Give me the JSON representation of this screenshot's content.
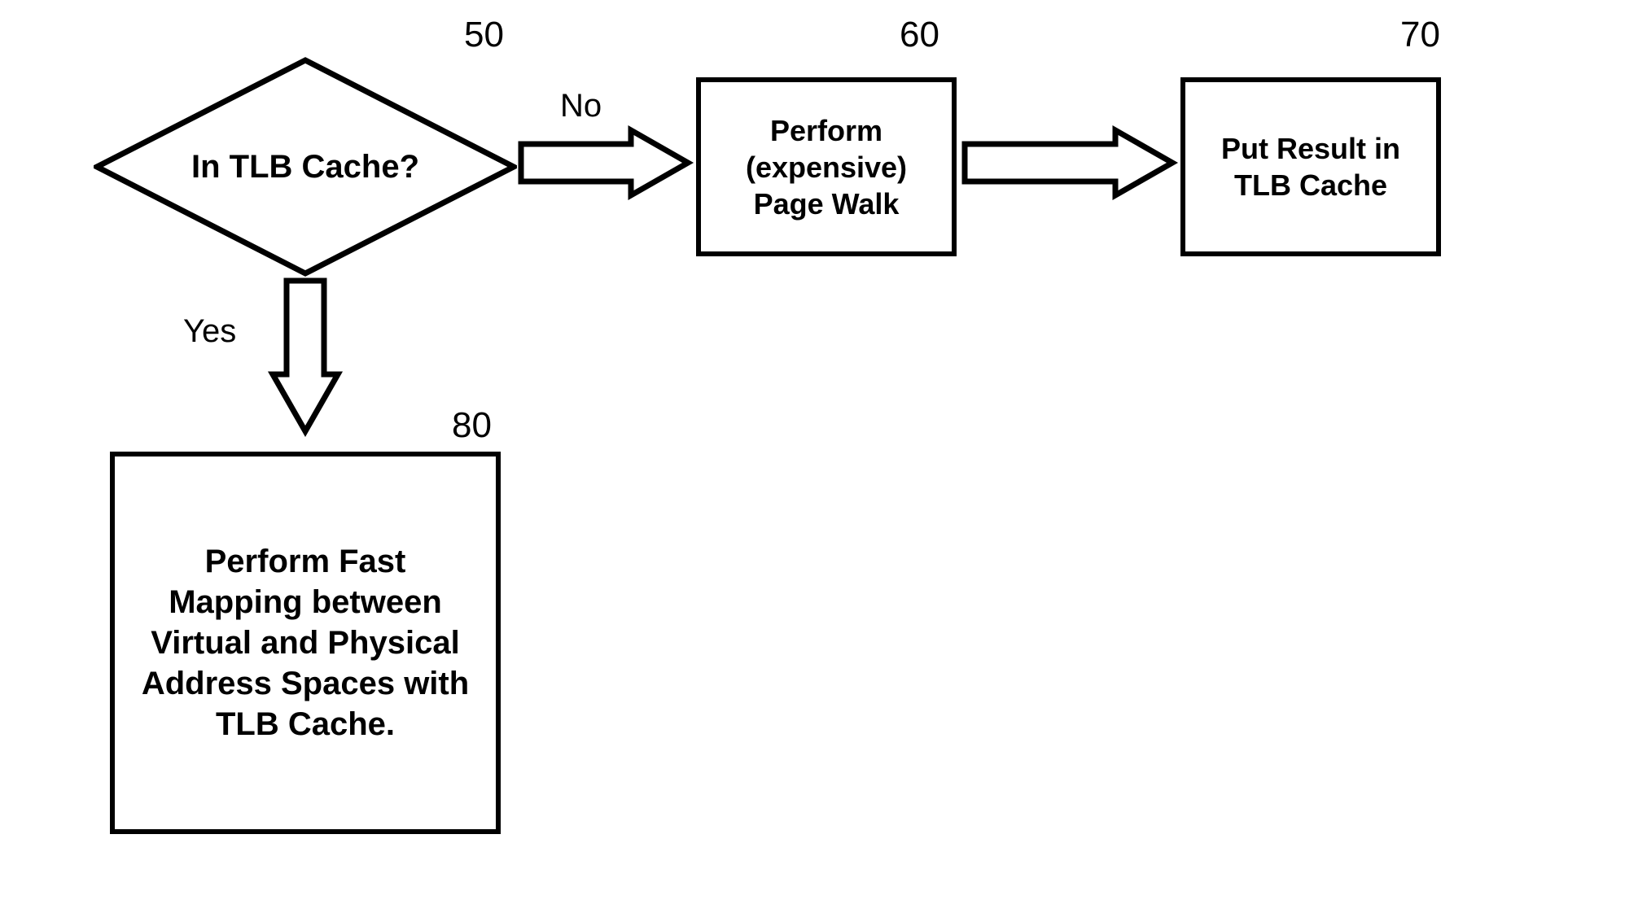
{
  "chart_data": {
    "type": "flowchart",
    "nodes": [
      {
        "id": 50,
        "shape": "decision",
        "text": "In TLB Cache?"
      },
      {
        "id": 60,
        "shape": "process",
        "text": "Perform (expensive) Page Walk"
      },
      {
        "id": 70,
        "shape": "process",
        "text": "Put Result in TLB Cache"
      },
      {
        "id": 80,
        "shape": "process",
        "text": "Perform Fast Mapping between Virtual and Physical Address Spaces with TLB Cache."
      }
    ],
    "edges": [
      {
        "from": 50,
        "to": 60,
        "label": "No"
      },
      {
        "from": 60,
        "to": 70,
        "label": ""
      },
      {
        "from": 50,
        "to": 80,
        "label": "Yes"
      }
    ]
  },
  "labels": {
    "n50": "50",
    "n60": "60",
    "n70": "70",
    "n80": "80",
    "edge_no": "No",
    "edge_yes": "Yes"
  },
  "nodes": {
    "n50_text": "In TLB Cache?",
    "n60_text": "Perform (expensive) Page Walk",
    "n70_text": "Put Result in TLB Cache",
    "n80_text": "Perform Fast Mapping between Virtual and Physical Address Spaces with TLB Cache."
  }
}
